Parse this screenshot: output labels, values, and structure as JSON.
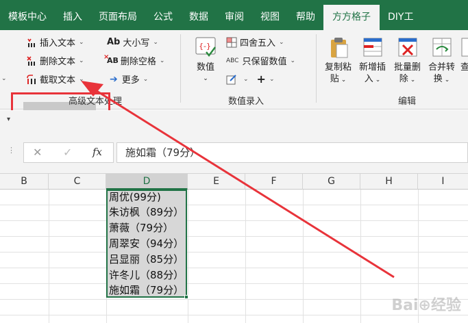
{
  "tabs": [
    {
      "label": "模板中心"
    },
    {
      "label": "插入"
    },
    {
      "label": "页面布局"
    },
    {
      "label": "公式"
    },
    {
      "label": "数据"
    },
    {
      "label": "审阅"
    },
    {
      "label": "视图"
    },
    {
      "label": "帮助"
    },
    {
      "label": "方方格子",
      "active": true
    },
    {
      "label": "DIY工"
    }
  ],
  "ribbon": {
    "text_group": {
      "insert_text": "插入文本",
      "delete_text": "删除文本",
      "extract_text": "截取文本",
      "case": "大小写",
      "delete_space": "删除空格",
      "more": "更多",
      "label": "高级文本处理",
      "ab_glyph": "Ab",
      "ab_glyph2": "AB"
    },
    "value_group": {
      "value_label": "数值",
      "round": "四舍五入",
      "keep_value": "只保留数值",
      "label": "数值录入",
      "abc_glyph": "ABC"
    },
    "edit_group": {
      "copy_paste_1": "复制粘",
      "copy_paste_2": "贴",
      "new_insert_1": "新增插",
      "new_insert_2": "入",
      "batch_delete_1": "批量删",
      "batch_delete_2": "除",
      "merge_convert_1": "合并转",
      "merge_convert_2": "换",
      "find_1": "查",
      "label": "编辑"
    }
  },
  "formula_bar": {
    "fx": "fx",
    "value": "施如霜（79分）"
  },
  "columns": [
    "B",
    "C",
    "D",
    "E",
    "F",
    "G",
    "H",
    "I"
  ],
  "cells": [
    "周优(99分)",
    "朱访枫（89分）",
    "萧薇（79分）",
    "周翠安（94分）",
    "吕显丽（85分）",
    "许冬儿（88分）",
    "施如霜（79分）"
  ],
  "colors": {
    "accent": "#217346",
    "highlight": "#e8333a"
  }
}
